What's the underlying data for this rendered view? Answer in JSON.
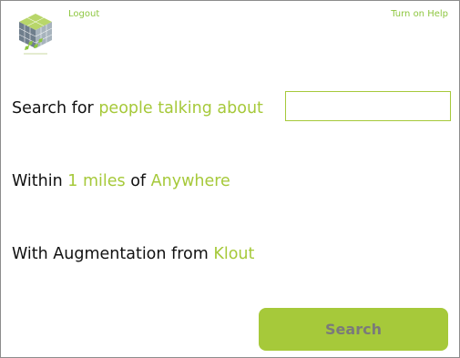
{
  "header": {
    "logo_icon": "cube-logo-icon",
    "logout_label": "Logout",
    "help_label": "Turn on Help"
  },
  "form": {
    "row1": {
      "prefix": "Search for",
      "mode": "people talking about",
      "query_value": "",
      "query_placeholder": ""
    },
    "row2": {
      "prefix": "Within",
      "distance": "1 miles",
      "connector": "of",
      "location": "Anywhere"
    },
    "row3": {
      "prefix": "With Augmentation from",
      "source": "Klout"
    }
  },
  "actions": {
    "search_label": "Search"
  },
  "colors": {
    "accent": "#a6c93a",
    "link": "#8dc63f",
    "button_text": "#7a7a7a",
    "text": "#111111",
    "border": "#8c8c8c"
  }
}
